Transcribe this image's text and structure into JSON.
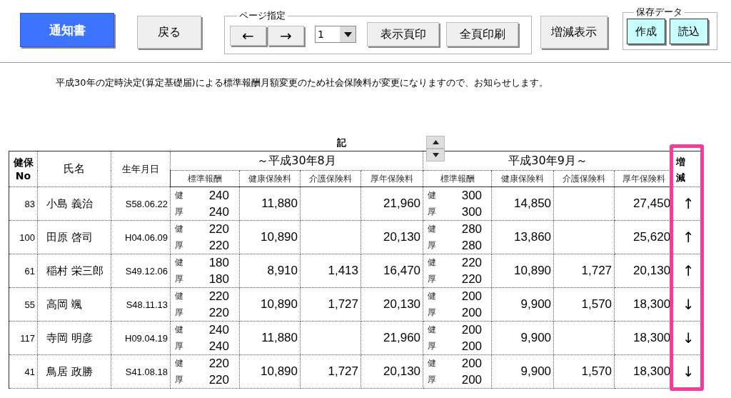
{
  "toolbar": {
    "buttons": [
      {
        "label": "通知書",
        "kind": "primary"
      },
      {
        "label": "戻る",
        "kind": "plain"
      }
    ],
    "page_group": {
      "title": "ページ指定",
      "prev": "←",
      "next": "→",
      "page_select": {
        "value": "1"
      },
      "buttons": [
        "表示頁印",
        "全頁印刷"
      ]
    },
    "change_button": "増減表示",
    "save_group": {
      "title": "保存データ",
      "buttons": [
        "作成",
        "読込"
      ]
    }
  },
  "notice": "平成30年の定時決定(算定基礎届)による標準報酬月額変更のため社会保険料が変更になりますので、お知らせします。",
  "heading": "記",
  "table": {
    "columns": {
      "no": "健保\nNo",
      "name": "氏名",
      "birth": "生年月日",
      "period_1": "～平成30年8月",
      "period_2": "平成30年9月～",
      "change": "増減",
      "sub_1": [
        "標準報酬",
        "健康保険料",
        "介護保険料",
        "厚年保険料"
      ],
      "sub_2": [
        "標準報酬",
        "健康保険料",
        "介護保険料",
        "厚年保険料"
      ]
    },
    "rows": [
      {
        "no": "83",
        "name": "小島 義治",
        "birth": "S58.06.22",
        "before": {
          "grade": [
            {
              "label": "健",
              "value": "240"
            },
            {
              "label": "厚",
              "value": "240"
            }
          ],
          "health": "11,880",
          "pension": "21,960"
        },
        "after": {
          "grade": [
            {
              "label": "健",
              "value": "300"
            },
            {
              "label": "厚",
              "value": "300"
            }
          ],
          "health": "14,850",
          "pension": "27,450"
        },
        "change": "↑"
      },
      {
        "no": "100",
        "name": "田原 啓司",
        "birth": "H04.06.09",
        "before": {
          "grade": [
            {
              "label": "健",
              "value": "220"
            },
            {
              "label": "厚",
              "value": "220"
            }
          ],
          "health": "10,890",
          "pension": "20,130"
        },
        "after": {
          "grade": [
            {
              "label": "健",
              "value": "280"
            },
            {
              "label": "厚",
              "value": "280"
            }
          ],
          "health": "13,860",
          "pension": "25,620"
        },
        "change": "↑"
      },
      {
        "no": "61",
        "name": "稲村 栄三郎",
        "birth": "S49.12.06",
        "before": {
          "grade": [
            {
              "label": "健",
              "value": "180"
            },
            {
              "label": "厚",
              "value": "180"
            }
          ],
          "health": "8,910",
          "care": "1,413",
          "pension": "16,470"
        },
        "after": {
          "grade": [
            {
              "label": "健",
              "value": "220"
            },
            {
              "label": "厚",
              "value": "220"
            }
          ],
          "health": "10,890",
          "care": "1,727",
          "pension": "20,130"
        },
        "change": "↑"
      },
      {
        "no": "55",
        "name": "高岡 颯",
        "birth": "S48.11.13",
        "before": {
          "grade": [
            {
              "label": "健",
              "value": "220"
            },
            {
              "label": "厚",
              "value": "220"
            }
          ],
          "health": "10,890",
          "care": "1,727",
          "pension": "20,130"
        },
        "after": {
          "grade": [
            {
              "label": "健",
              "value": "200"
            },
            {
              "label": "厚",
              "value": "200"
            }
          ],
          "health": "9,900",
          "care": "1,570",
          "pension": "18,300"
        },
        "change": "↓"
      },
      {
        "no": "117",
        "name": "寺岡 明彦",
        "birth": "H09.04.19",
        "before": {
          "grade": [
            {
              "label": "健",
              "value": "240"
            },
            {
              "label": "厚",
              "value": "240"
            }
          ],
          "health": "11,880",
          "pension": "21,960"
        },
        "after": {
          "grade": [
            {
              "label": "健",
              "value": "200"
            },
            {
              "label": "厚",
              "value": "200"
            }
          ],
          "health": "9,900",
          "pension": "18,300"
        },
        "change": "↓"
      },
      {
        "no": "41",
        "name": "鳥居 政勝",
        "birth": "S41.08.18",
        "before": {
          "grade": [
            {
              "label": "健",
              "value": "220"
            },
            {
              "label": "厚",
              "value": "220"
            }
          ],
          "health": "10,890",
          "care": "1,727",
          "pension": "20,130"
        },
        "after": {
          "grade": [
            {
              "label": "健",
              "value": "200"
            },
            {
              "label": "厚",
              "value": "200"
            }
          ],
          "health": "9,900",
          "care": "1,570",
          "pension": "18,300"
        },
        "change": "↓"
      }
    ]
  }
}
